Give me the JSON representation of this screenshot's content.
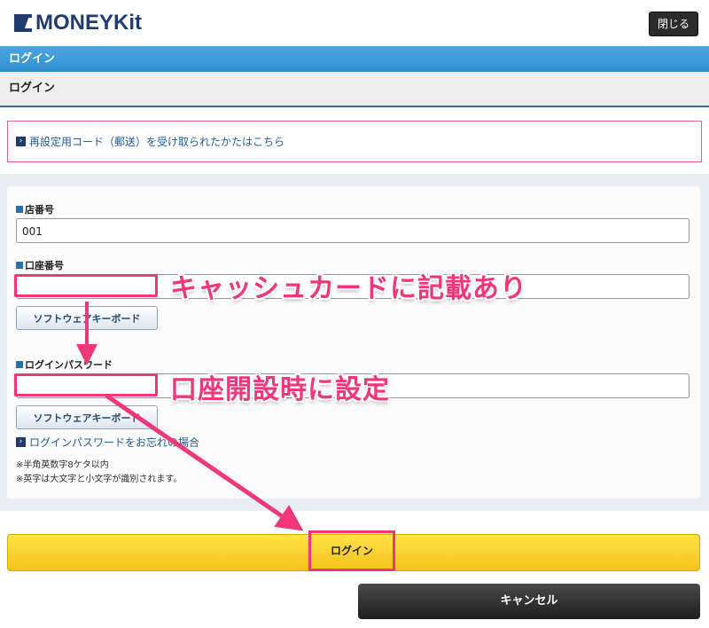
{
  "header": {
    "logo_text": "MONEYKit",
    "close_label": "閉じる"
  },
  "title_bar": "ログイン",
  "subtitle": "ログイン",
  "notice": {
    "link_text": "再設定用コード（郵送）を受け取られたかたはこちら"
  },
  "form": {
    "branch": {
      "label": "店番号",
      "value": "001"
    },
    "account": {
      "label": "口座番号",
      "value": "",
      "keyboard_label": "ソフトウェアキーボード"
    },
    "password": {
      "label": "ログインパスワード",
      "value": "",
      "keyboard_label": "ソフトウェアキーボード"
    },
    "forgot_link": "ログインパスワードをお忘れの場合",
    "notes": [
      "※半角英数字8ケタ以内",
      "※英字は大文字と小文字が識別されます。"
    ]
  },
  "annotations": {
    "account_note": "キャッシュカードに記載あり",
    "password_note": "口座開設時に設定"
  },
  "buttons": {
    "login": "ログイン",
    "cancel": "キャンセル"
  },
  "colors": {
    "accent_pink": "#f0377a",
    "title_blue": "#3a9ad9",
    "login_yellow": "#f8d02a",
    "cancel_dark": "#2b2b2b"
  }
}
